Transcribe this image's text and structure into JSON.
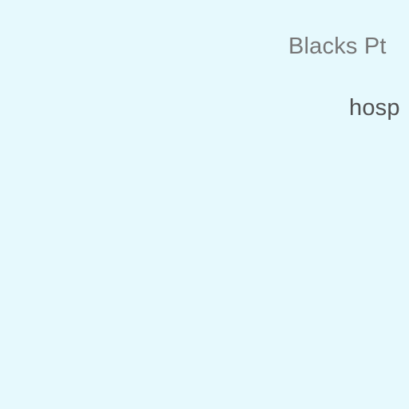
{
  "map": {
    "background_color": "#e6f9fd",
    "labels": [
      {
        "text": "Blacks Pt",
        "color": "#777777"
      },
      {
        "text": "hosp",
        "color": "#505050"
      }
    ]
  }
}
